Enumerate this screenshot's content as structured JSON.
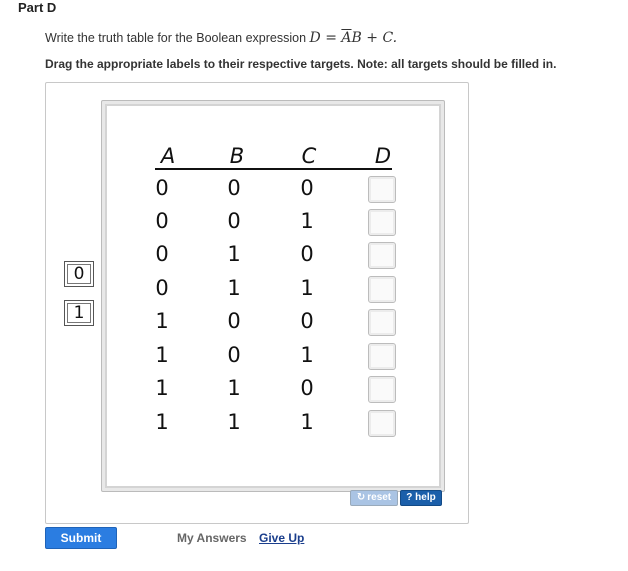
{
  "part_title": "Part D",
  "prompt": {
    "text": "Write the truth table for the Boolean expression",
    "expr_lhs": "D",
    "expr_eq": " = ",
    "expr_a": "A",
    "expr_b": "B",
    "expr_plus": " + ",
    "expr_c": "C",
    "expr_end": "."
  },
  "instruction": "Drag the appropriate labels to their respective targets. Note: all targets should be filled in.",
  "table": {
    "headers": [
      "A",
      "B",
      "C",
      "D"
    ],
    "rows": [
      [
        "0",
        "0",
        "0"
      ],
      [
        "0",
        "0",
        "1"
      ],
      [
        "0",
        "1",
        "0"
      ],
      [
        "0",
        "1",
        "1"
      ],
      [
        "1",
        "0",
        "0"
      ],
      [
        "1",
        "0",
        "1"
      ],
      [
        "1",
        "1",
        "0"
      ],
      [
        "1",
        "1",
        "1"
      ]
    ]
  },
  "labels": [
    "0",
    "1"
  ],
  "buttons": {
    "reset": "reset",
    "help": "? help",
    "submit": "Submit",
    "my_answers": "My Answers",
    "give_up": "Give Up"
  },
  "colors": {
    "submit": "#2b7de1",
    "help": "#1b5faa",
    "reset": "#aac4e4",
    "give_up_link": "#1a3e8c"
  },
  "icons": {
    "reset": "refresh-icon"
  }
}
